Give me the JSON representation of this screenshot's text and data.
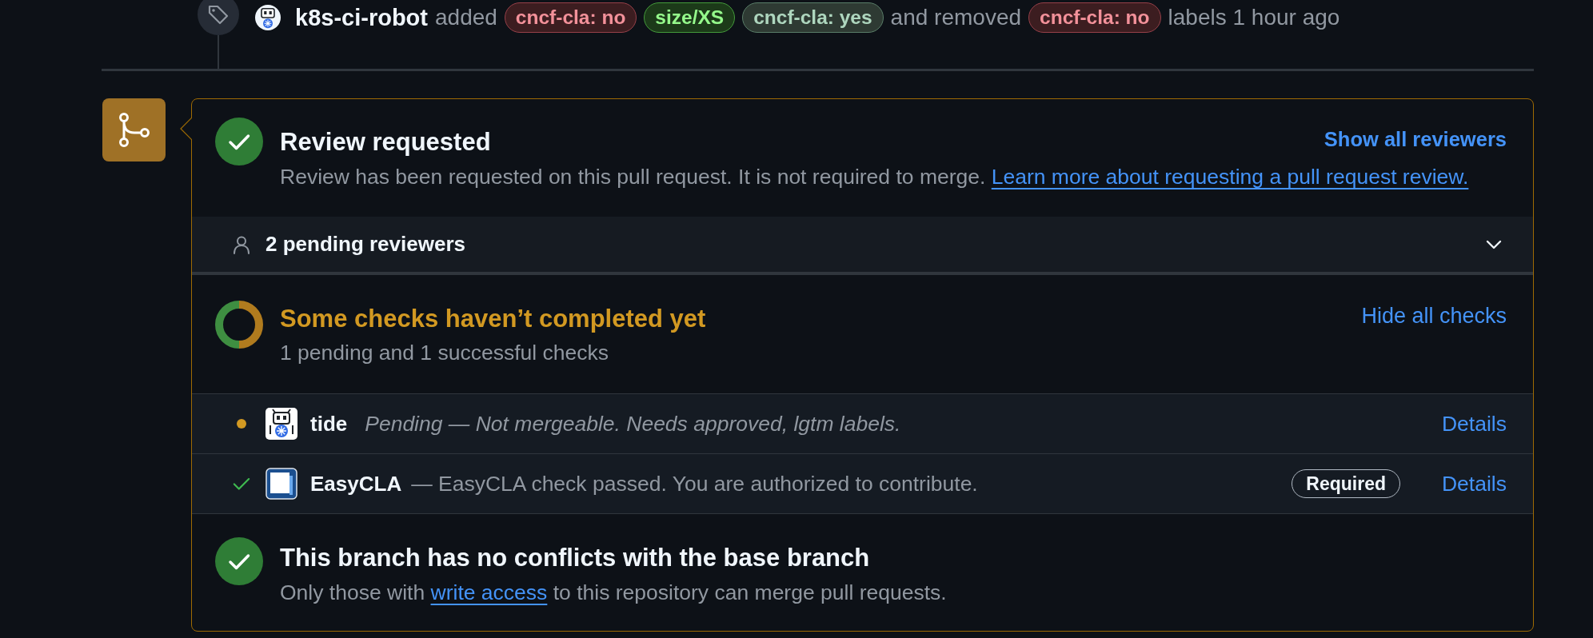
{
  "event": {
    "actor": "k8s-ci-robot",
    "added_text": "added",
    "added_labels": [
      {
        "text": "cncf-cla: no",
        "color": "#3c1d20"
      },
      {
        "text": "size/XS",
        "color": "#1c3a19"
      },
      {
        "text": "cncf-cla: yes",
        "color": "#2e3a33"
      }
    ],
    "removed_text": "and removed",
    "removed_labels": [
      {
        "text": "cncf-cla: no",
        "color": "#3c1d20"
      }
    ],
    "time_text": "labels 1 hour ago"
  },
  "merge_box": {
    "review": {
      "completed": true,
      "title": "Review requested",
      "description": "Review has been requested on this pull request. It is not required to merge.",
      "link": "Learn more about requesting a pull request review.",
      "action": "Show all reviewers"
    },
    "reviewers": {
      "label": "2 pending reviewers",
      "expanded": false
    },
    "checks": {
      "completed": false,
      "title": "Some checks haven’t completed yet",
      "summary": "1 pending and 1 successful checks",
      "action": "Hide all checks",
      "items": [
        {
          "name": "tide",
          "completed": false,
          "description": "Pending — Not mergeable. Needs approved, lgtm labels.",
          "action": "Details"
        },
        {
          "name": "EasyCLA",
          "completed": true,
          "description": "— EasyCLA check passed. You are authorized to contribute.",
          "badge": "Required",
          "action": "Details"
        }
      ]
    },
    "merge": {
      "completed": true,
      "title": "This branch has no conflicts with the base branch",
      "description": "Only those with",
      "link": "write access",
      "description_end": "to this repository can merge pull requests."
    }
  }
}
